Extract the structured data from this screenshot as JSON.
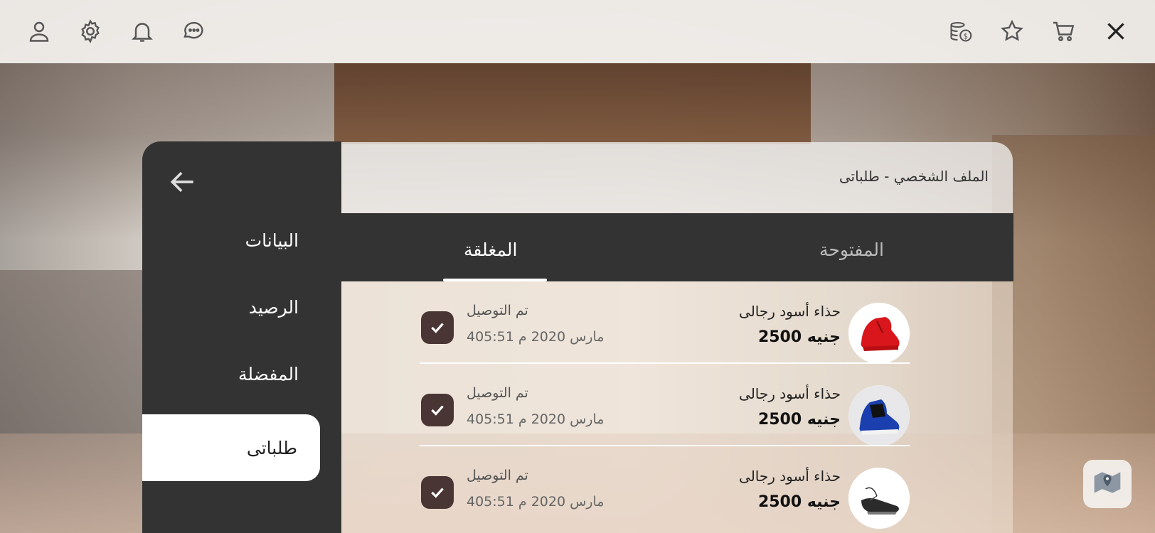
{
  "topbar": {
    "left_icons": [
      "user-icon",
      "gear-icon",
      "bell-icon",
      "chat-icon"
    ],
    "right_icons": [
      "coins-icon",
      "star-icon",
      "cart-icon",
      "close-icon"
    ]
  },
  "sidebar": {
    "items": [
      {
        "label": "البيانات"
      },
      {
        "label": "الرصيد"
      },
      {
        "label": "المفضلة"
      },
      {
        "label": "طلباتى"
      }
    ]
  },
  "header": {
    "title": "الملف الشخصي - طلباتى"
  },
  "tabs": {
    "open": "المفتوحة",
    "closed": "المغلقة",
    "active": "closed"
  },
  "orders": [
    {
      "name": "حذاء أسود رجالى",
      "price": "2500 جنيه",
      "status": "تم التوصيل",
      "date": "4مارس 2020  م 05:51",
      "image": "red-sneaker"
    },
    {
      "name": "حذاء أسود رجالى",
      "price": "2500 جنيه",
      "status": "تم التوصيل",
      "date": "4مارس 2020  م 05:51",
      "image": "blue-sneaker"
    },
    {
      "name": "حذاء أسود رجالى",
      "price": "2500 جنيه",
      "status": "تم التوصيل",
      "date": "4مارس 2020  م 05:51",
      "image": "black-sneaker"
    }
  ],
  "colors": {
    "panel": "#333333",
    "check": "#4a3535",
    "accent_white": "#ffffff"
  }
}
